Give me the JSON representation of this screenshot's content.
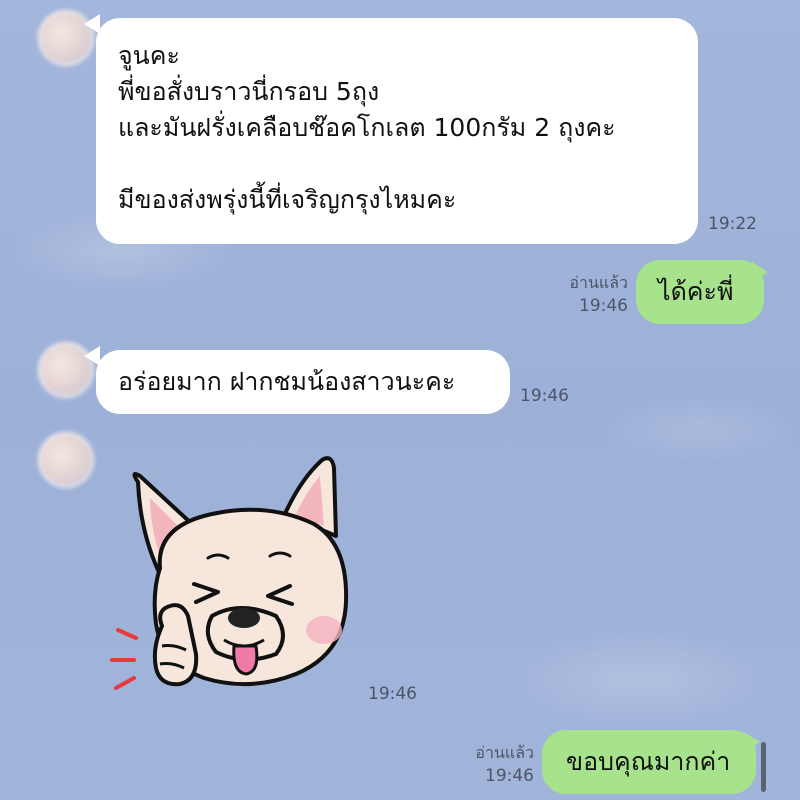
{
  "conversation": {
    "messages": [
      {
        "direction": "incoming",
        "lines": [
          "จูนคะ",
          "พี่ขอสั่งบราวนี่กรอบ 5ถุง",
          "และมันฝรั่งเคลือบช๊อคโกเลต 100กรัม 2 ถุงคะ",
          "",
          "มีของส่งพรุ่งนี้ที่เจริญกรุงไหมคะ"
        ],
        "time": "19:22"
      },
      {
        "direction": "outgoing",
        "lines": [
          "ได้ค่ะพี่"
        ],
        "read_status": "อ่านแล้ว",
        "time": "19:46"
      },
      {
        "direction": "incoming",
        "lines": [
          "อร่อยมาก ฝากชมน้องสาวนะคะ"
        ],
        "time": "19:46"
      },
      {
        "direction": "incoming",
        "type": "sticker",
        "sticker_icon": "winking-bulldog-sticker",
        "time": "19:46"
      },
      {
        "direction": "outgoing",
        "lines": [
          "ขอบคุณมากค่า"
        ],
        "read_status": "อ่านแล้ว",
        "time": "19:46"
      }
    ]
  },
  "colors": {
    "background": "#9fb3d9",
    "incoming_bubble": "#ffffff",
    "outgoing_bubble": "#a7e38c",
    "timestamp": "#4a5668"
  }
}
